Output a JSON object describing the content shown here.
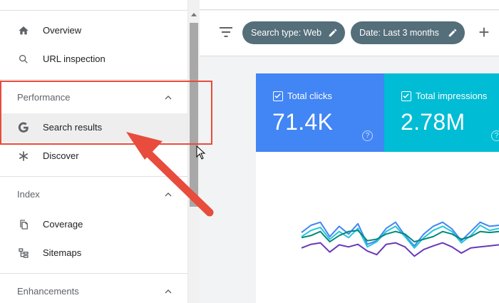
{
  "sidebar": {
    "items_top": [
      {
        "label": "Overview",
        "icon": "home-icon"
      },
      {
        "label": "URL inspection",
        "icon": "search-icon"
      }
    ],
    "sections": [
      {
        "title": "Performance",
        "items": [
          {
            "label": "Search results",
            "icon": "google-g-icon",
            "active": true
          },
          {
            "label": "Discover",
            "icon": "asterisk-icon"
          }
        ]
      },
      {
        "title": "Index",
        "items": [
          {
            "label": "Coverage",
            "icon": "pages-icon"
          },
          {
            "label": "Sitemaps",
            "icon": "sitemap-icon"
          }
        ]
      },
      {
        "title": "Enhancements",
        "items": []
      }
    ]
  },
  "toolbar": {
    "chips": [
      {
        "label": "Search type: Web"
      },
      {
        "label": "Date: Last 3 months"
      }
    ],
    "add_label": "+"
  },
  "metrics": [
    {
      "label": "Total clicks",
      "value": "71.4K",
      "color": "#4285f4"
    },
    {
      "label": "Total impressions",
      "value": "2.78M",
      "color": "#00bcd4"
    }
  ],
  "chart_data": {
    "type": "line",
    "series": [
      {
        "color": "#4285f4",
        "values": [
          32,
          18,
          12,
          40,
          20,
          35,
          15,
          55,
          48,
          24,
          12,
          38,
          58,
          35,
          20,
          12,
          25,
          48,
          30,
          12,
          20,
          18
        ]
      },
      {
        "color": "#26c6da",
        "values": [
          40,
          28,
          22,
          45,
          30,
          42,
          24,
          60,
          50,
          30,
          20,
          40,
          62,
          42,
          28,
          20,
          30,
          52,
          38,
          18,
          28,
          24
        ]
      },
      {
        "color": "#00897b",
        "values": [
          42,
          38,
          30,
          50,
          38,
          30,
          28,
          48,
          45,
          35,
          30,
          35,
          50,
          45,
          40,
          30,
          35,
          45,
          40,
          30,
          32,
          30
        ]
      },
      {
        "color": "#673ab7",
        "values": [
          62,
          55,
          52,
          70,
          56,
          60,
          55,
          68,
          75,
          55,
          52,
          60,
          78,
          65,
          58,
          52,
          60,
          72,
          62,
          60,
          58,
          56
        ]
      }
    ]
  },
  "colors": {
    "highlight": "#e74c3c",
    "chip": "#546e7a"
  }
}
